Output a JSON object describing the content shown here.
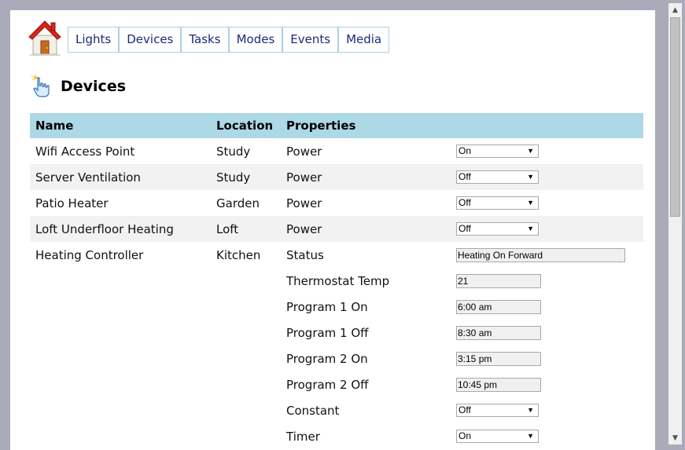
{
  "nav": {
    "items": [
      "Lights",
      "Devices",
      "Tasks",
      "Modes",
      "Events",
      "Media"
    ]
  },
  "page": {
    "title": "Devices"
  },
  "table": {
    "headers": {
      "name": "Name",
      "location": "Location",
      "properties": "Properties"
    },
    "rows": [
      {
        "name": "Wifi Access Point",
        "location": "Study",
        "property": "Power",
        "value": "On"
      },
      {
        "name": "Server Ventilation",
        "location": "Study",
        "property": "Power",
        "value": "Off"
      },
      {
        "name": "Patio Heater",
        "location": "Garden",
        "property": "Power",
        "value": "Off"
      },
      {
        "name": "Loft Underfloor Heating",
        "location": "Loft",
        "property": "Power",
        "value": "Off"
      },
      {
        "name": "Heating Controller",
        "location": "Kitchen",
        "property": "Status",
        "value": "Heating On Forward"
      },
      {
        "name": "",
        "location": "",
        "property": "Thermostat Temp",
        "value": "21"
      },
      {
        "name": "",
        "location": "",
        "property": "Program 1 On",
        "value": "6:00 am"
      },
      {
        "name": "",
        "location": "",
        "property": "Program 1 Off",
        "value": "8:30 am"
      },
      {
        "name": "",
        "location": "",
        "property": "Program 2 On",
        "value": "3:15 pm"
      },
      {
        "name": "",
        "location": "",
        "property": "Program 2 Off",
        "value": "10:45 pm"
      },
      {
        "name": "",
        "location": "",
        "property": "Constant",
        "value": "Off"
      },
      {
        "name": "",
        "location": "",
        "property": "Timer",
        "value": "On"
      }
    ]
  },
  "colors": {
    "header_bg": "#add8e6",
    "nav_text": "#1a2a7a",
    "nav_border": "#a8d4e0"
  }
}
